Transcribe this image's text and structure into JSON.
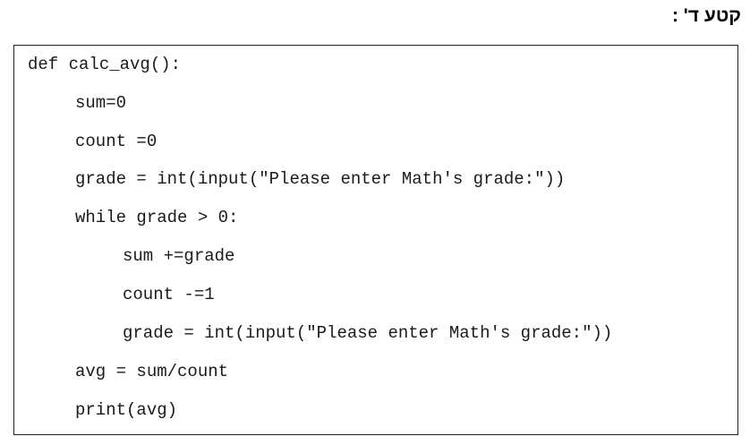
{
  "heading": "קטע ד' :",
  "code": {
    "lines": [
      "def calc_avg():",
      "sum=0",
      "count =0",
      "grade = int(input(\"Please enter Math's grade:\"))",
      "while grade > 0:",
      "sum +=grade",
      "count -=1",
      "grade = int(input(\"Please enter Math's grade:\"))",
      "avg = sum/count",
      "print(avg)"
    ]
  }
}
